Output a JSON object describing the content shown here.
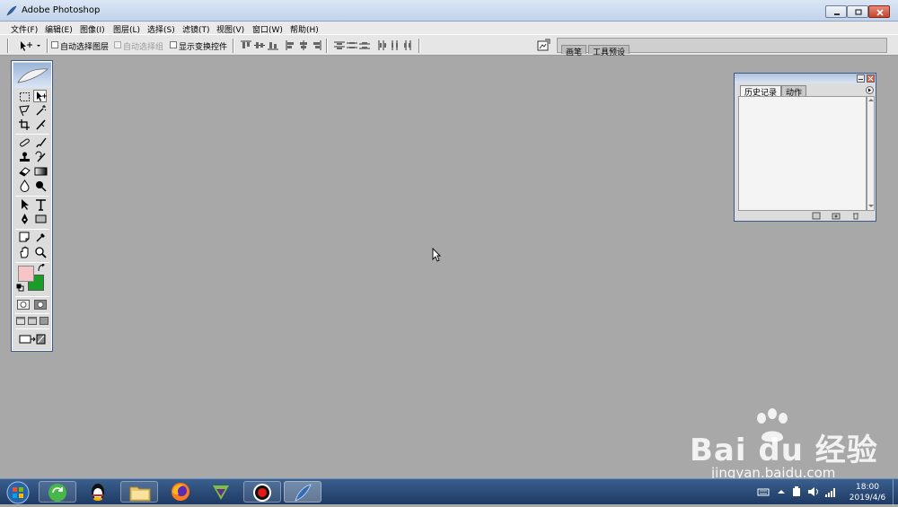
{
  "window": {
    "title": "Adobe Photoshop"
  },
  "menu": [
    "文件(F)",
    "编辑(E)",
    "图像(I)",
    "图层(L)",
    "选择(S)",
    "滤镜(T)",
    "视图(V)",
    "窗口(W)",
    "帮助(H)"
  ],
  "options": {
    "auto_select_layer": "自动选择图层",
    "auto_select_group": "自动选择组",
    "show_transform_controls": "显示变换控件"
  },
  "palette_well": {
    "tabs": [
      "画笔",
      "工具预设"
    ]
  },
  "history_panel": {
    "tabs": [
      "历史记录",
      "动作"
    ]
  },
  "colors": {
    "foreground": "#f6c6c6",
    "background": "#1a9d28",
    "window_accent": "#3c5a88"
  },
  "watermark": {
    "logo": "Bai du 经验",
    "site": "jingyan.baidu.com"
  },
  "taskbar": {
    "items": [
      "start-orb",
      "qq",
      "explorer",
      "firefox",
      "media-player",
      "record",
      "photoshop"
    ]
  },
  "clock": {
    "time": "18:00",
    "date": "2019/4/6"
  }
}
